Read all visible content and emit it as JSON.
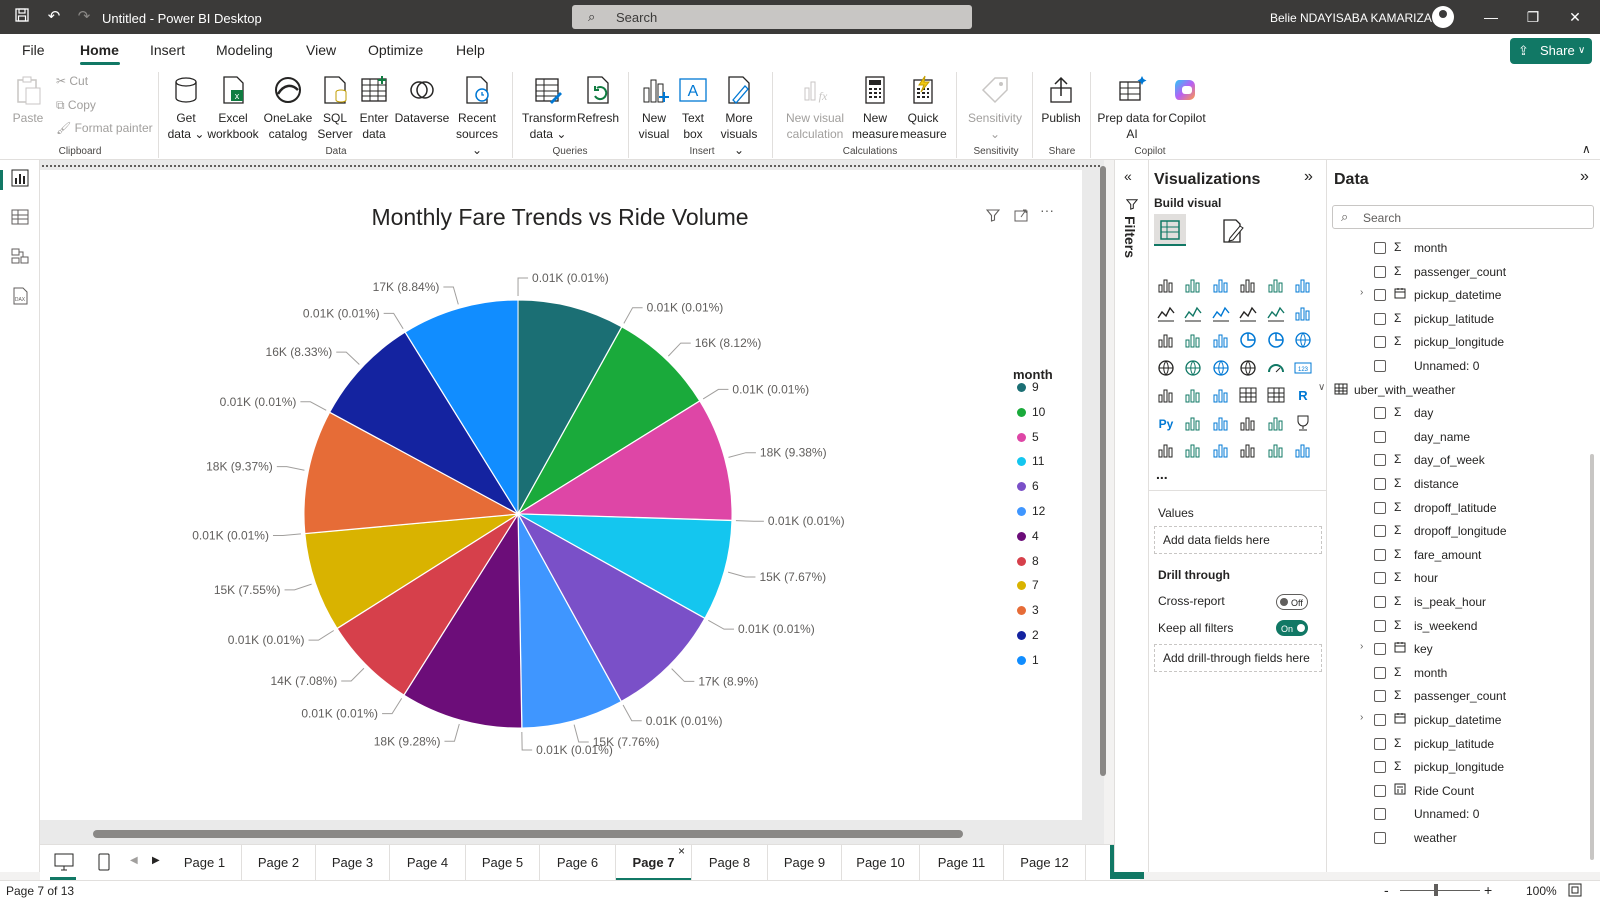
{
  "app": {
    "title": "Untitled - Power BI Desktop",
    "search_placeholder": "Search",
    "user": "Belie NDAYISABA KAMARIZA"
  },
  "menu": {
    "tabs": [
      "File",
      "Home",
      "Insert",
      "Modeling",
      "View",
      "Optimize",
      "Help"
    ],
    "share": "Share"
  },
  "ribbon": {
    "clipboard": {
      "paste": "Paste",
      "cut": "Cut",
      "copy": "Copy",
      "format_painter": "Format painter",
      "group": "Clipboard"
    },
    "data": {
      "get_data": "Get data",
      "excel": "Excel workbook",
      "onelake": "OneLake catalog",
      "sql": "SQL Server",
      "enter": "Enter data",
      "dataverse": "Dataverse",
      "recent": "Recent sources",
      "group": "Data"
    },
    "queries": {
      "transform": "Transform data",
      "refresh": "Refresh",
      "group": "Queries"
    },
    "insert": {
      "new_visual": "New visual",
      "text_box": "Text box",
      "more_visuals": "More visuals",
      "group": "Insert"
    },
    "calculations": {
      "new_visual_calc": "New visual calculation",
      "new_measure": "New measure",
      "quick_measure": "Quick measure",
      "group": "Calculations"
    },
    "sensitivity": {
      "label": "Sensitivity",
      "group": "Sensitivity"
    },
    "share": {
      "publish": "Publish",
      "group": "Share"
    },
    "copilot": {
      "prep": "Prep data for AI",
      "copilot": "Copilot",
      "group": "Copilot"
    }
  },
  "chart_data": {
    "type": "pie",
    "title": "Monthly Fare Trends vs Ride Volume",
    "legend_title": "month",
    "legend_position": "right",
    "slices": [
      {
        "month": "9",
        "color": "#1b6f74",
        "label": "0.01K (0.01%)",
        "value": 0.01
      },
      {
        "month": "9",
        "color": "#1b6f74",
        "label": "",
        "value": 15.98
      },
      {
        "month": "10",
        "color": "#1aaa3b",
        "label": "0.01K (0.01%)",
        "value": 0.01
      },
      {
        "month": "10",
        "color": "#1aaa3b",
        "label": "16K (8.12%)",
        "value": 16
      },
      {
        "month": "5",
        "color": "#de46a6",
        "label": "0.01K (0.01%)",
        "value": 0.01
      },
      {
        "month": "5",
        "color": "#de46a6",
        "label": "18K (9.38%)",
        "value": 18.5
      },
      {
        "month": "11",
        "color": "#14c6ef",
        "label": "0.01K (0.01%)",
        "value": 0.01
      },
      {
        "month": "11",
        "color": "#14c6ef",
        "label": "15K (7.67%)",
        "value": 15.1
      },
      {
        "month": "6",
        "color": "#7a50c8",
        "label": "0.01K (0.01%)",
        "value": 0.01
      },
      {
        "month": "6",
        "color": "#7a50c8",
        "label": "17K (8.9%)",
        "value": 17.6
      },
      {
        "month": "12",
        "color": "#3f96ff",
        "label": "0.01K (0.01%)",
        "value": 0.01
      },
      {
        "month": "12",
        "color": "#3f96ff",
        "label": "15K (7.76%)",
        "value": 15.3
      },
      {
        "month": "4",
        "color": "#6c0d79",
        "label": "0.01K (0.01%)",
        "value": 0.01
      },
      {
        "month": "4",
        "color": "#6c0d79",
        "label": "18K (9.28%)",
        "value": 18.3
      },
      {
        "month": "8",
        "color": "#d6404b",
        "label": "0.01K (0.01%)",
        "value": 0.01
      },
      {
        "month": "8",
        "color": "#d6404b",
        "label": "14K (7.08%)",
        "value": 14
      },
      {
        "month": "7",
        "color": "#d9b300",
        "label": "0.01K (0.01%)",
        "value": 0.01
      },
      {
        "month": "7",
        "color": "#d9b300",
        "label": "15K (7.55%)",
        "value": 14.9
      },
      {
        "month": "3",
        "color": "#e66c37",
        "label": "0.01K (0.01%)",
        "value": 0.01
      },
      {
        "month": "3",
        "color": "#e66c37",
        "label": "18K (9.37%)",
        "value": 18.5
      },
      {
        "month": "2",
        "color": "#1423a0",
        "label": "0.01K (0.01%)",
        "value": 0.01
      },
      {
        "month": "2",
        "color": "#1423a0",
        "label": "16K (8.33%)",
        "value": 16.4
      },
      {
        "month": "1",
        "color": "#118dff",
        "label": "0.01K (0.01%)",
        "value": 0.01
      },
      {
        "month": "1",
        "color": "#118dff",
        "label": "17K (8.84%)",
        "value": 17.5
      }
    ],
    "legend": [
      {
        "label": "9",
        "color": "#1b6f74"
      },
      {
        "label": "10",
        "color": "#1aaa3b"
      },
      {
        "label": "5",
        "color": "#de46a6"
      },
      {
        "label": "11",
        "color": "#14c6ef"
      },
      {
        "label": "6",
        "color": "#7a50c8"
      },
      {
        "label": "12",
        "color": "#3f96ff"
      },
      {
        "label": "4",
        "color": "#6c0d79"
      },
      {
        "label": "8",
        "color": "#d6404b"
      },
      {
        "label": "7",
        "color": "#d9b300"
      },
      {
        "label": "3",
        "color": "#e66c37"
      },
      {
        "label": "2",
        "color": "#1423a0"
      },
      {
        "label": "1",
        "color": "#118dff"
      }
    ]
  },
  "pages": {
    "tabs": [
      "Page 1",
      "Page 2",
      "Page 3",
      "Page 4",
      "Page 5",
      "Page 6",
      "Page 7",
      "Page 8",
      "Page 9",
      "Page 10",
      "Page 11",
      "Page 12"
    ],
    "active_index": 6,
    "close": "×",
    "add": "+"
  },
  "status": {
    "page_info": "Page 7 of 13",
    "zoom": "100%",
    "zoom_minus": "-",
    "zoom_plus": "+"
  },
  "filters": {
    "label": "Filters"
  },
  "visualizations": {
    "title": "Visualizations",
    "build_visual": "Build visual",
    "values": "Values",
    "add_data_fields": "Add data fields here",
    "drill_through": "Drill through",
    "cross_report": "Cross-report",
    "cross_report_state": "Off",
    "keep_all_filters": "Keep all filters",
    "keep_all_filters_state": "On",
    "add_drill_fields": "Add drill-through fields here",
    "more": "...",
    "py_label": "Py",
    "r_label": "R",
    "num_label": "123"
  },
  "data_pane": {
    "title": "Data",
    "search_placeholder": "Search",
    "fields": [
      {
        "name": "month",
        "type": "Σ",
        "expand": ""
      },
      {
        "name": "passenger_count",
        "type": "Σ",
        "expand": ""
      },
      {
        "name": "pickup_datetime",
        "type": "cal",
        "expand": ">"
      },
      {
        "name": "pickup_latitude",
        "type": "Σ",
        "expand": ""
      },
      {
        "name": "pickup_longitude",
        "type": "Σ",
        "expand": ""
      },
      {
        "name": "Unnamed: 0",
        "type": "",
        "expand": ""
      },
      {
        "name": "uber_with_weather",
        "type": "table",
        "expand": "v"
      },
      {
        "name": "day",
        "type": "Σ",
        "expand": ""
      },
      {
        "name": "day_name",
        "type": "",
        "expand": ""
      },
      {
        "name": "day_of_week",
        "type": "Σ",
        "expand": ""
      },
      {
        "name": "distance",
        "type": "Σ",
        "expand": ""
      },
      {
        "name": "dropoff_latitude",
        "type": "Σ",
        "expand": ""
      },
      {
        "name": "dropoff_longitude",
        "type": "Σ",
        "expand": ""
      },
      {
        "name": "fare_amount",
        "type": "Σ",
        "expand": ""
      },
      {
        "name": "hour",
        "type": "Σ",
        "expand": ""
      },
      {
        "name": "is_peak_hour",
        "type": "Σ",
        "expand": ""
      },
      {
        "name": "is_weekend",
        "type": "Σ",
        "expand": ""
      },
      {
        "name": "key",
        "type": "cal",
        "expand": ">"
      },
      {
        "name": "month",
        "type": "Σ",
        "expand": ""
      },
      {
        "name": "passenger_count",
        "type": "Σ",
        "expand": ""
      },
      {
        "name": "pickup_datetime",
        "type": "cal",
        "expand": ">"
      },
      {
        "name": "pickup_latitude",
        "type": "Σ",
        "expand": ""
      },
      {
        "name": "pickup_longitude",
        "type": "Σ",
        "expand": ""
      },
      {
        "name": "Ride Count",
        "type": "calc",
        "expand": ""
      },
      {
        "name": "Unnamed: 0",
        "type": "",
        "expand": ""
      },
      {
        "name": "weather",
        "type": "",
        "expand": ""
      }
    ]
  },
  "colors": {
    "accent": "#117865",
    "titlebar": "#3b3a39"
  }
}
